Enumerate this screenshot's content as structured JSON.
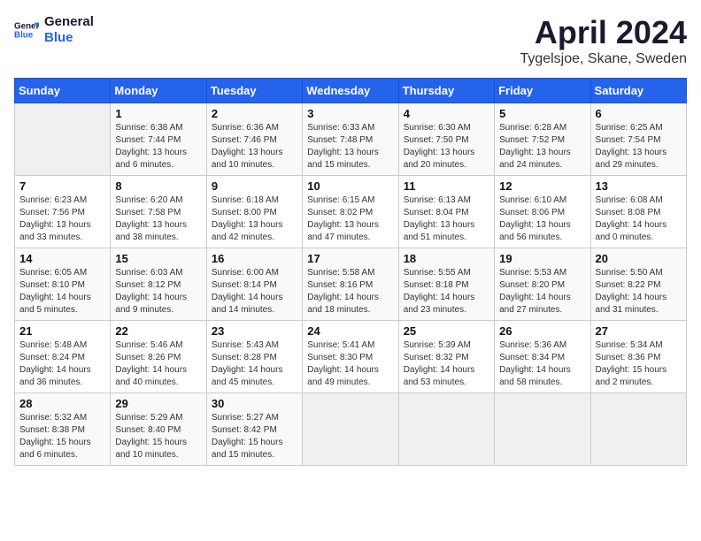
{
  "header": {
    "logo_general": "General",
    "logo_blue": "Blue",
    "month_title": "April 2024",
    "location": "Tygelsjoe, Skane, Sweden"
  },
  "days_of_week": [
    "Sunday",
    "Monday",
    "Tuesday",
    "Wednesday",
    "Thursday",
    "Friday",
    "Saturday"
  ],
  "weeks": [
    [
      {
        "num": "",
        "lines": []
      },
      {
        "num": "1",
        "lines": [
          "Sunrise: 6:38 AM",
          "Sunset: 7:44 PM",
          "Daylight: 13 hours",
          "and 6 minutes."
        ]
      },
      {
        "num": "2",
        "lines": [
          "Sunrise: 6:36 AM",
          "Sunset: 7:46 PM",
          "Daylight: 13 hours",
          "and 10 minutes."
        ]
      },
      {
        "num": "3",
        "lines": [
          "Sunrise: 6:33 AM",
          "Sunset: 7:48 PM",
          "Daylight: 13 hours",
          "and 15 minutes."
        ]
      },
      {
        "num": "4",
        "lines": [
          "Sunrise: 6:30 AM",
          "Sunset: 7:50 PM",
          "Daylight: 13 hours",
          "and 20 minutes."
        ]
      },
      {
        "num": "5",
        "lines": [
          "Sunrise: 6:28 AM",
          "Sunset: 7:52 PM",
          "Daylight: 13 hours",
          "and 24 minutes."
        ]
      },
      {
        "num": "6",
        "lines": [
          "Sunrise: 6:25 AM",
          "Sunset: 7:54 PM",
          "Daylight: 13 hours",
          "and 29 minutes."
        ]
      }
    ],
    [
      {
        "num": "7",
        "lines": [
          "Sunrise: 6:23 AM",
          "Sunset: 7:56 PM",
          "Daylight: 13 hours",
          "and 33 minutes."
        ]
      },
      {
        "num": "8",
        "lines": [
          "Sunrise: 6:20 AM",
          "Sunset: 7:58 PM",
          "Daylight: 13 hours",
          "and 38 minutes."
        ]
      },
      {
        "num": "9",
        "lines": [
          "Sunrise: 6:18 AM",
          "Sunset: 8:00 PM",
          "Daylight: 13 hours",
          "and 42 minutes."
        ]
      },
      {
        "num": "10",
        "lines": [
          "Sunrise: 6:15 AM",
          "Sunset: 8:02 PM",
          "Daylight: 13 hours",
          "and 47 minutes."
        ]
      },
      {
        "num": "11",
        "lines": [
          "Sunrise: 6:13 AM",
          "Sunset: 8:04 PM",
          "Daylight: 13 hours",
          "and 51 minutes."
        ]
      },
      {
        "num": "12",
        "lines": [
          "Sunrise: 6:10 AM",
          "Sunset: 8:06 PM",
          "Daylight: 13 hours",
          "and 56 minutes."
        ]
      },
      {
        "num": "13",
        "lines": [
          "Sunrise: 6:08 AM",
          "Sunset: 8:08 PM",
          "Daylight: 14 hours",
          "and 0 minutes."
        ]
      }
    ],
    [
      {
        "num": "14",
        "lines": [
          "Sunrise: 6:05 AM",
          "Sunset: 8:10 PM",
          "Daylight: 14 hours",
          "and 5 minutes."
        ]
      },
      {
        "num": "15",
        "lines": [
          "Sunrise: 6:03 AM",
          "Sunset: 8:12 PM",
          "Daylight: 14 hours",
          "and 9 minutes."
        ]
      },
      {
        "num": "16",
        "lines": [
          "Sunrise: 6:00 AM",
          "Sunset: 8:14 PM",
          "Daylight: 14 hours",
          "and 14 minutes."
        ]
      },
      {
        "num": "17",
        "lines": [
          "Sunrise: 5:58 AM",
          "Sunset: 8:16 PM",
          "Daylight: 14 hours",
          "and 18 minutes."
        ]
      },
      {
        "num": "18",
        "lines": [
          "Sunrise: 5:55 AM",
          "Sunset: 8:18 PM",
          "Daylight: 14 hours",
          "and 23 minutes."
        ]
      },
      {
        "num": "19",
        "lines": [
          "Sunrise: 5:53 AM",
          "Sunset: 8:20 PM",
          "Daylight: 14 hours",
          "and 27 minutes."
        ]
      },
      {
        "num": "20",
        "lines": [
          "Sunrise: 5:50 AM",
          "Sunset: 8:22 PM",
          "Daylight: 14 hours",
          "and 31 minutes."
        ]
      }
    ],
    [
      {
        "num": "21",
        "lines": [
          "Sunrise: 5:48 AM",
          "Sunset: 8:24 PM",
          "Daylight: 14 hours",
          "and 36 minutes."
        ]
      },
      {
        "num": "22",
        "lines": [
          "Sunrise: 5:46 AM",
          "Sunset: 8:26 PM",
          "Daylight: 14 hours",
          "and 40 minutes."
        ]
      },
      {
        "num": "23",
        "lines": [
          "Sunrise: 5:43 AM",
          "Sunset: 8:28 PM",
          "Daylight: 14 hours",
          "and 45 minutes."
        ]
      },
      {
        "num": "24",
        "lines": [
          "Sunrise: 5:41 AM",
          "Sunset: 8:30 PM",
          "Daylight: 14 hours",
          "and 49 minutes."
        ]
      },
      {
        "num": "25",
        "lines": [
          "Sunrise: 5:39 AM",
          "Sunset: 8:32 PM",
          "Daylight: 14 hours",
          "and 53 minutes."
        ]
      },
      {
        "num": "26",
        "lines": [
          "Sunrise: 5:36 AM",
          "Sunset: 8:34 PM",
          "Daylight: 14 hours",
          "and 58 minutes."
        ]
      },
      {
        "num": "27",
        "lines": [
          "Sunrise: 5:34 AM",
          "Sunset: 8:36 PM",
          "Daylight: 15 hours",
          "and 2 minutes."
        ]
      }
    ],
    [
      {
        "num": "28",
        "lines": [
          "Sunrise: 5:32 AM",
          "Sunset: 8:38 PM",
          "Daylight: 15 hours",
          "and 6 minutes."
        ]
      },
      {
        "num": "29",
        "lines": [
          "Sunrise: 5:29 AM",
          "Sunset: 8:40 PM",
          "Daylight: 15 hours",
          "and 10 minutes."
        ]
      },
      {
        "num": "30",
        "lines": [
          "Sunrise: 5:27 AM",
          "Sunset: 8:42 PM",
          "Daylight: 15 hours",
          "and 15 minutes."
        ]
      },
      {
        "num": "",
        "lines": []
      },
      {
        "num": "",
        "lines": []
      },
      {
        "num": "",
        "lines": []
      },
      {
        "num": "",
        "lines": []
      }
    ]
  ]
}
